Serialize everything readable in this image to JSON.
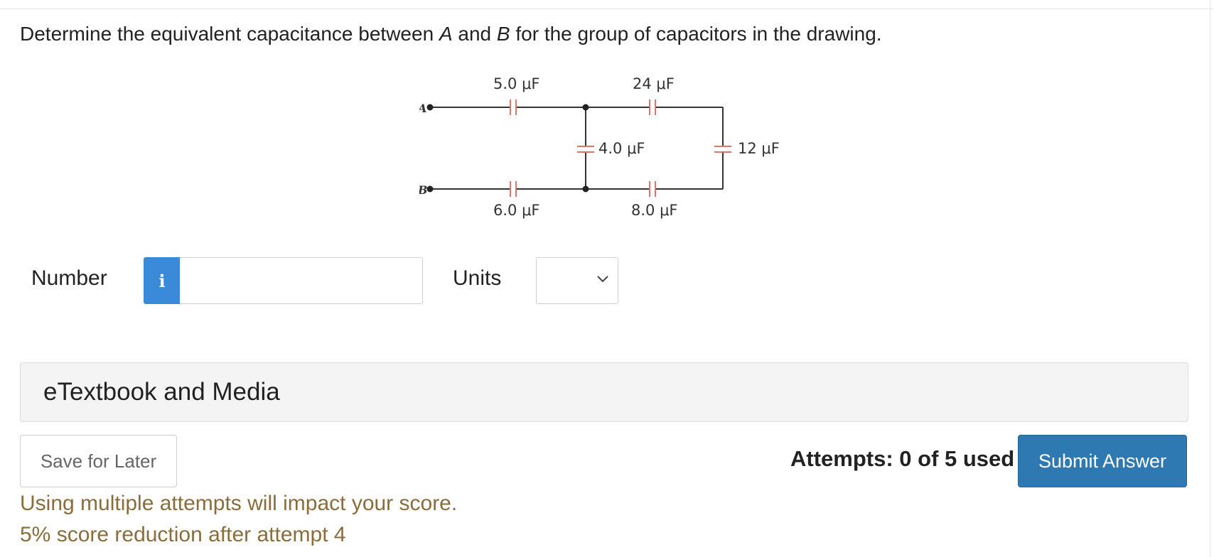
{
  "question": {
    "part1": "Determine the equivalent capacitance between ",
    "node_a": "A",
    "part2": " and ",
    "node_b": "B",
    "part3": " for the group of capacitors in the drawing."
  },
  "circuit": {
    "node_a": "A",
    "node_b": "B",
    "capacitors": {
      "top_left": "5.0 μF",
      "top_right": "24 μF",
      "middle": "4.0 μF",
      "right": "12 μF",
      "bottom_left": "6.0 μF",
      "bottom_right": "8.0 μF"
    },
    "wire_color": "#333333",
    "capacitor_color": "#e0736a"
  },
  "answer_form": {
    "number_label": "Number",
    "info_icon": "i",
    "number_value": "",
    "units_label": "Units",
    "units_selected": ""
  },
  "etextbook": {
    "label": "eTextbook and Media"
  },
  "actions": {
    "save_label": "Save for Later",
    "attempts_text": "Attempts: 0 of 5 used",
    "submit_label": "Submit Answer"
  },
  "notices": {
    "line1": "Using multiple attempts will impact your score.",
    "line2": "5% score reduction after attempt 4"
  },
  "colors": {
    "accent": "#2f79b3",
    "info": "#3b8ad9",
    "warning_text": "#8a6d3b"
  }
}
